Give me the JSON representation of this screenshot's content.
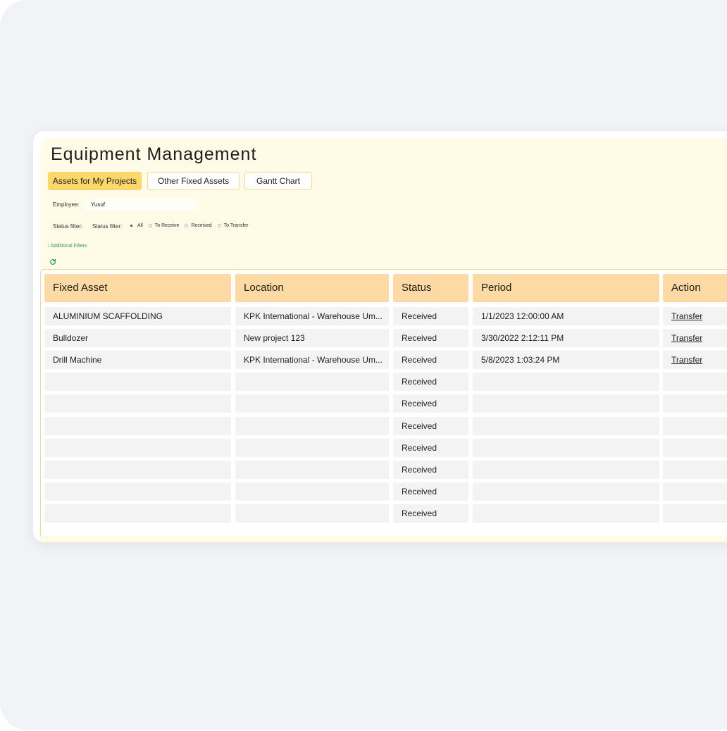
{
  "app": {
    "title": "Equipment Management"
  },
  "tabs": [
    {
      "label": "Assets for My Projects",
      "active": true
    },
    {
      "label": "Other Fixed Assets",
      "active": false
    },
    {
      "label": "Gantt Chart",
      "active": false
    }
  ],
  "filters": {
    "employee_label": "Employee:",
    "employee_value": "Yusuf",
    "status_label": "Status filter:",
    "status_label_inner": "Status filter:",
    "status_options": [
      {
        "label": "All",
        "selected": true
      },
      {
        "label": "To Receive",
        "selected": false
      },
      {
        "label": "Received",
        "selected": false
      },
      {
        "label": "To Transfer",
        "selected": false
      }
    ],
    "additional_filters": "Additional Filters"
  },
  "icons": {
    "refresh": "refresh-icon",
    "chevron": "chevron-right-icon"
  },
  "colors": {
    "accent": "#fcd769",
    "header": "#fddaa4",
    "panel": "#fffbe6",
    "link_green": "#2e9b5c"
  },
  "table": {
    "columns": [
      "Fixed Asset",
      "Location",
      "Status",
      "Period",
      "Action"
    ],
    "rows": [
      {
        "asset": "ALUMINIUM SCAFFOLDING",
        "location": "KPK International - Warehouse Um...",
        "status": "Received",
        "period": "1/1/2023 12:00:00 AM",
        "action": "Transfer"
      },
      {
        "asset": "Bulldozer",
        "location": "New project 123",
        "status": "Received",
        "period": "3/30/2022 2:12:11 PM",
        "action": "Transfer"
      },
      {
        "asset": "Drill Machine",
        "location": "KPK International - Warehouse Um...",
        "status": "Received",
        "period": "5/8/2023 1:03:24 PM",
        "action": "Transfer"
      },
      {
        "asset": "",
        "location": "",
        "status": "Received",
        "period": "",
        "action": ""
      },
      {
        "asset": "",
        "location": "",
        "status": "Received",
        "period": "",
        "action": ""
      },
      {
        "asset": "",
        "location": "",
        "status": "Received",
        "period": "",
        "action": ""
      },
      {
        "asset": "",
        "location": "",
        "status": "Received",
        "period": "",
        "action": ""
      },
      {
        "asset": "",
        "location": "",
        "status": "Received",
        "period": "",
        "action": ""
      },
      {
        "asset": "",
        "location": "",
        "status": "Received",
        "period": "",
        "action": ""
      },
      {
        "asset": "",
        "location": "",
        "status": "Received",
        "period": "",
        "action": ""
      }
    ]
  }
}
